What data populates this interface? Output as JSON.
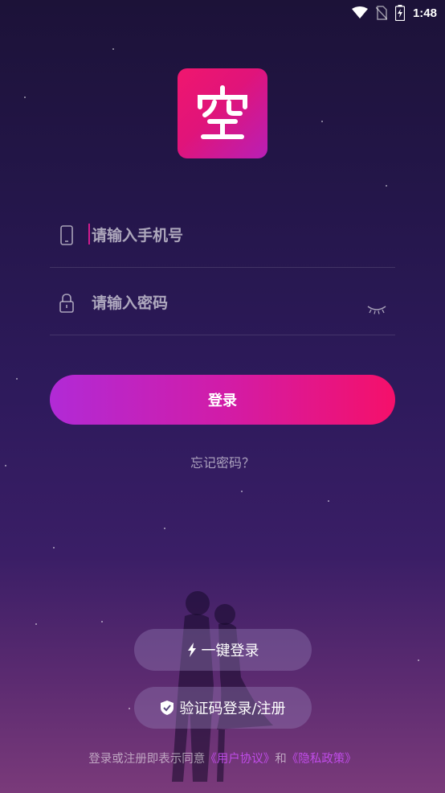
{
  "status_bar": {
    "time": "1:48"
  },
  "logo": {
    "char": "空"
  },
  "phone_field": {
    "placeholder": "请输入手机号"
  },
  "password_field": {
    "placeholder": "请输入密码"
  },
  "login_button": {
    "label": "登录"
  },
  "forgot_password": {
    "label": "忘记密码？"
  },
  "quick_login": {
    "label": "一键登录"
  },
  "code_login": {
    "label": "验证码登录/注册"
  },
  "agreement": {
    "prefix": "登录或注册即表示同意",
    "user_agreement": "《用户协议》",
    "and": "和",
    "privacy_policy": "《隐私政策》"
  },
  "colors": {
    "accent_pink": "#f5106a",
    "accent_purple": "#b12ad6",
    "link": "#c04ce8"
  },
  "icons": [
    "wifi-icon",
    "no-sim-icon",
    "battery-icon",
    "phone-icon",
    "lock-icon",
    "eye-closed-icon",
    "lightning-icon",
    "shield-check-icon"
  ]
}
